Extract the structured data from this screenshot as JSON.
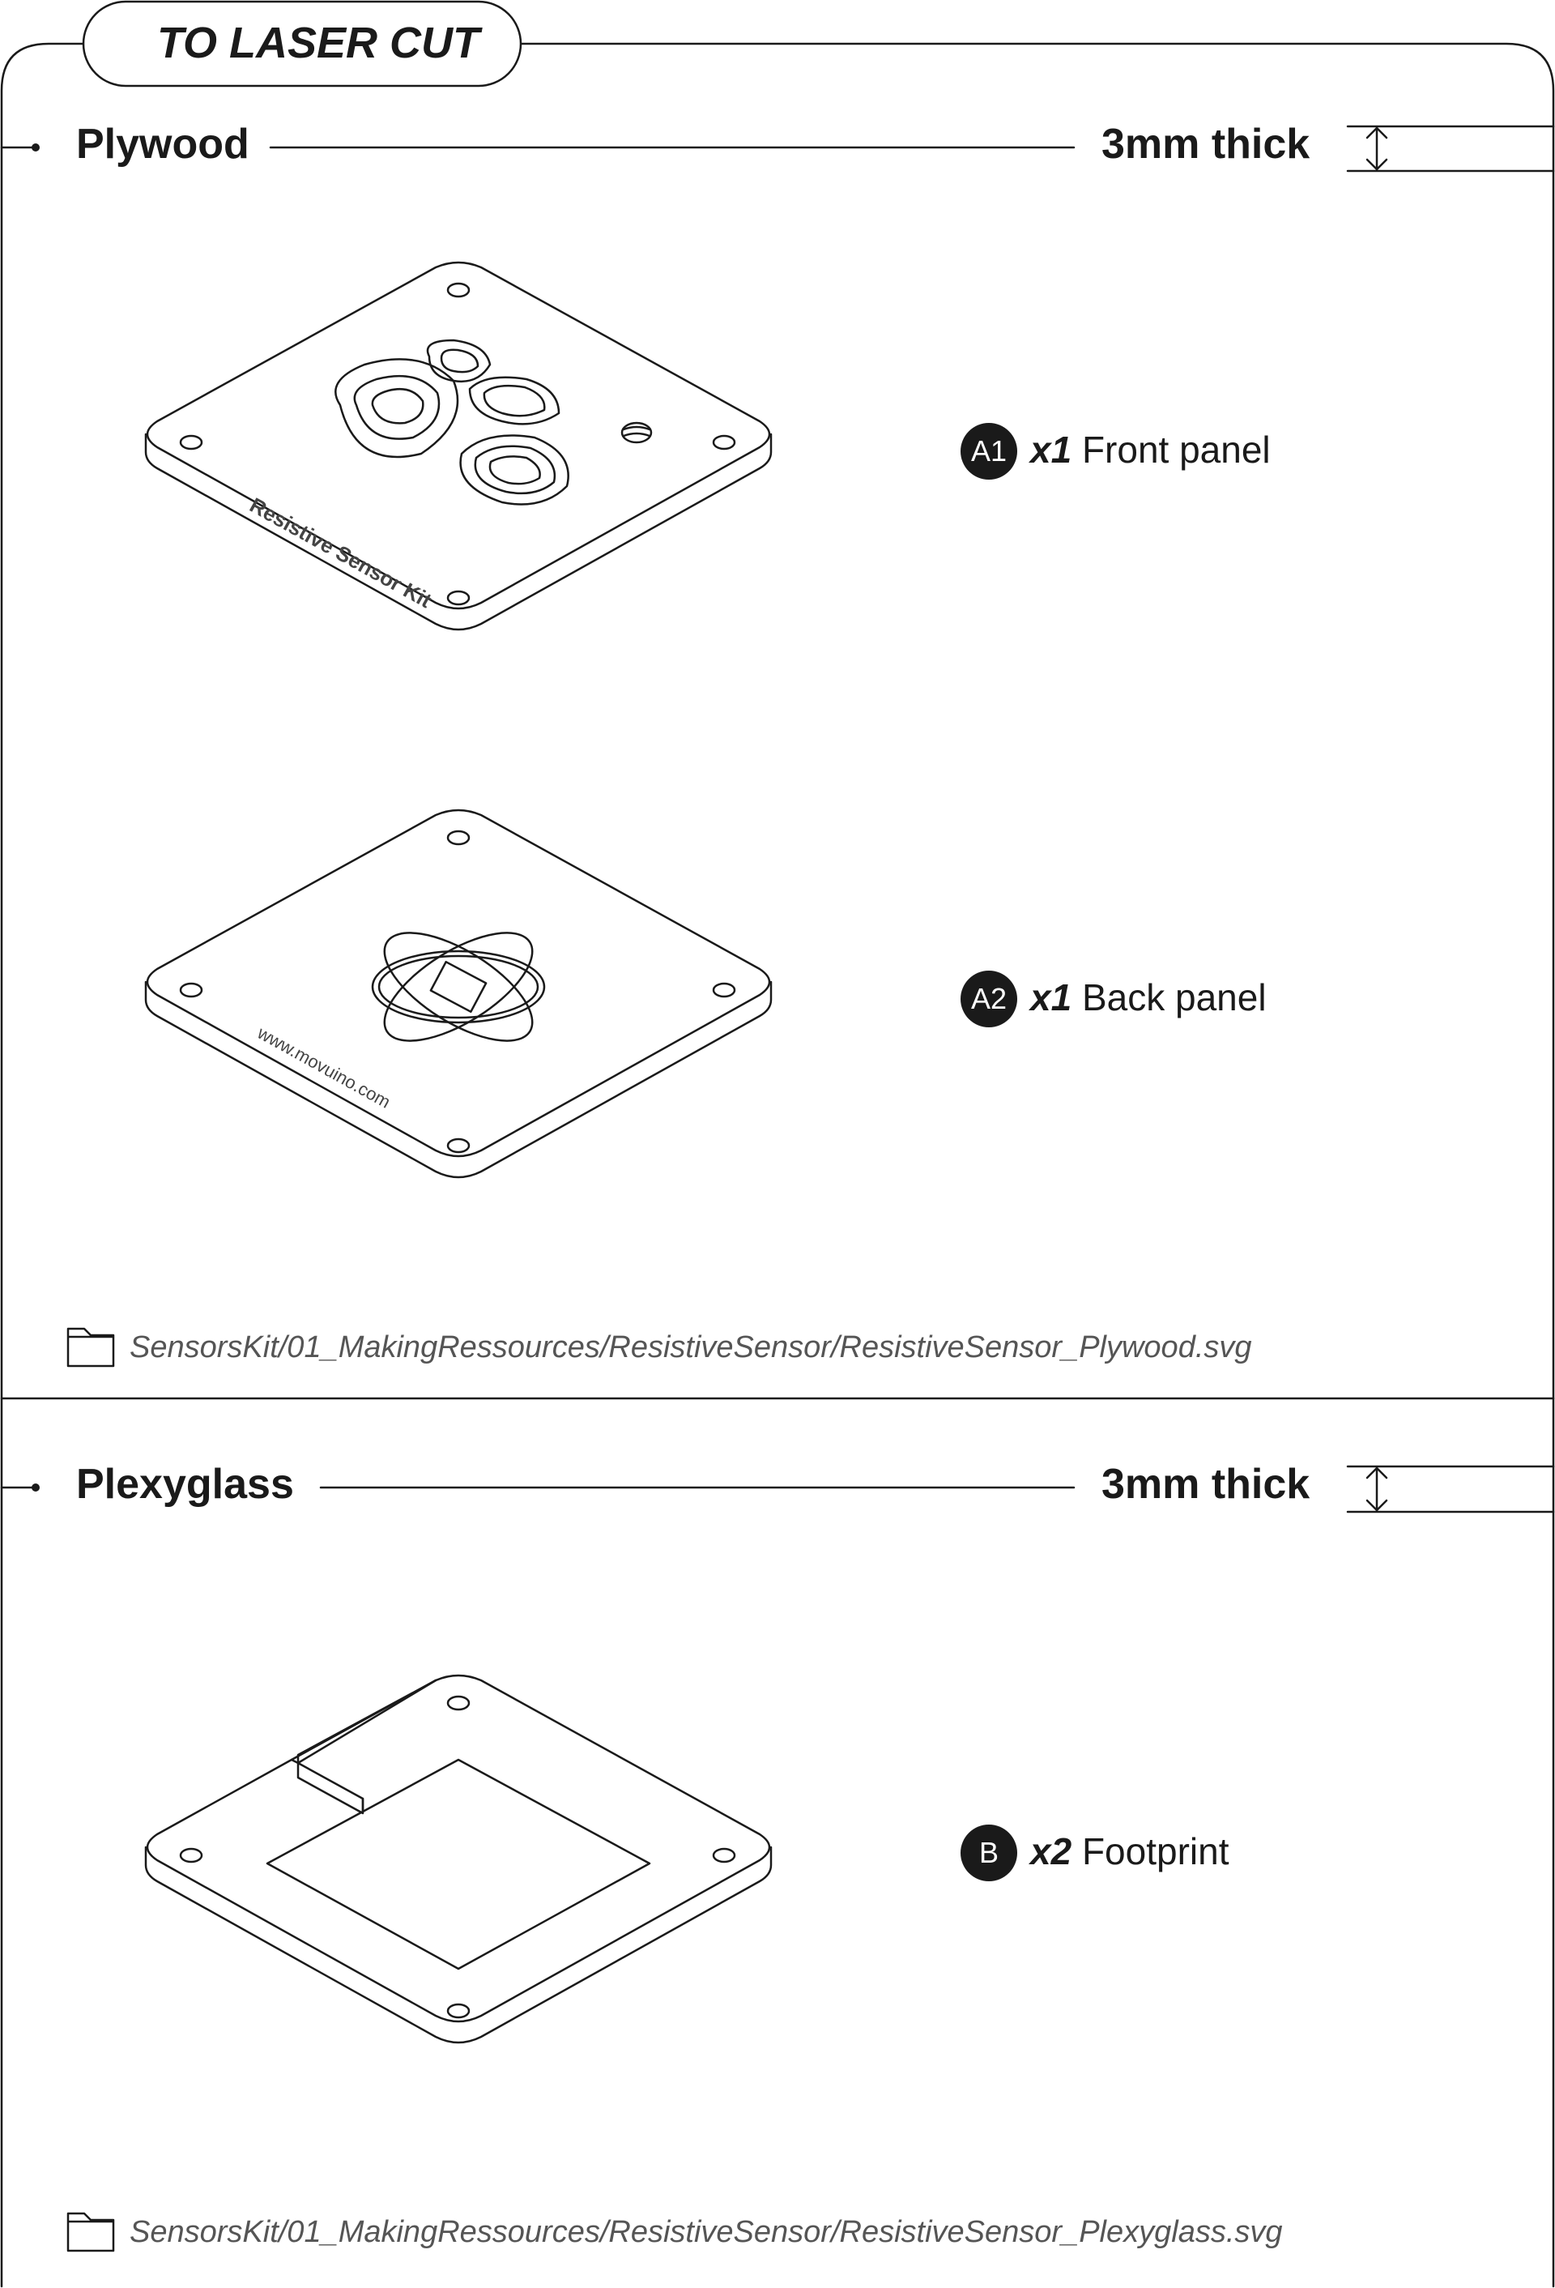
{
  "header": {
    "title": "TO LASER CUT"
  },
  "sections": [
    {
      "material": "Plywood",
      "thickness": "3mm thick",
      "parts": [
        {
          "badge": "A1",
          "qty": "x1",
          "name": "Front panel",
          "engraving": "Resistive Sensor Kit"
        },
        {
          "badge": "A2",
          "qty": "x1",
          "name": "Back panel",
          "engraving": "www.movuino.com"
        }
      ],
      "file_path": "SensorsKit/01_MakingRessources/ResistiveSensor/ResistiveSensor_Plywood.svg"
    },
    {
      "material": "Plexyglass",
      "thickness": "3mm thick",
      "parts": [
        {
          "badge": "B",
          "qty": "x2",
          "name": "Footprint"
        }
      ],
      "file_path": "SensorsKit/01_MakingRessources/ResistiveSensor/ResistiveSensor_Plexyglass.svg"
    }
  ],
  "icons": [
    "folder-icon",
    "thickness-arrow-icon",
    "bullet-dot-icon"
  ]
}
